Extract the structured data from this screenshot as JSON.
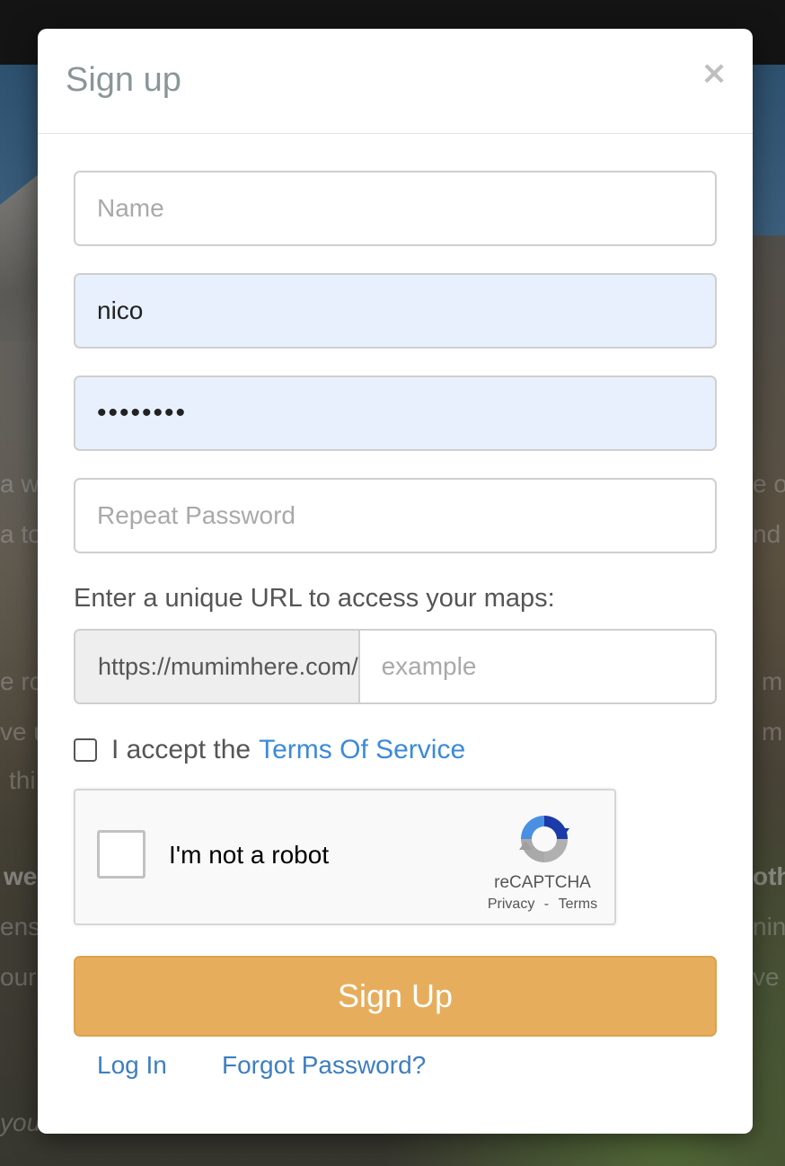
{
  "background": {
    "text_fragments": [
      {
        "text": "a w"
      },
      {
        "text": "a to"
      },
      {
        "text": "e ro"
      },
      {
        "text": "ve u"
      },
      {
        "text": "thi"
      },
      {
        "text": "we"
      },
      {
        "text": "ensi"
      },
      {
        "text": "our"
      },
      {
        "text": "you"
      },
      {
        "text": "e of"
      },
      {
        "text": "nd"
      },
      {
        "text": "m"
      },
      {
        "text": "m"
      },
      {
        "text": "oth"
      },
      {
        "text": "ning"
      },
      {
        "text": "ve"
      }
    ]
  },
  "modal": {
    "title": "Sign up",
    "close_glyph": "×",
    "fields": {
      "name": {
        "placeholder": "Name",
        "value": ""
      },
      "username": {
        "placeholder": "",
        "value": "nico"
      },
      "password": {
        "placeholder": "",
        "value": "••••••••"
      },
      "repeat_password": {
        "placeholder": "Repeat Password",
        "value": ""
      }
    },
    "url": {
      "label": "Enter a unique URL to access your maps:",
      "prefix": "https://mumimhere.com/",
      "placeholder": "example"
    },
    "tos": {
      "prefix": "I accept the",
      "link": "Terms Of Service",
      "checked": false
    },
    "recaptcha": {
      "label": "I'm not a robot",
      "brand": "reCAPTCHA",
      "privacy": "Privacy",
      "separator": "-",
      "terms": "Terms",
      "icon": "recaptcha-logo-icon"
    },
    "submit_label": "Sign Up",
    "footer_links": {
      "login": "Log In",
      "forgot": "Forgot Password?"
    }
  },
  "colors": {
    "accent_button": "#e6ae5c",
    "link": "#3c8ad9",
    "autofill_bg": "#e8f0fe"
  }
}
